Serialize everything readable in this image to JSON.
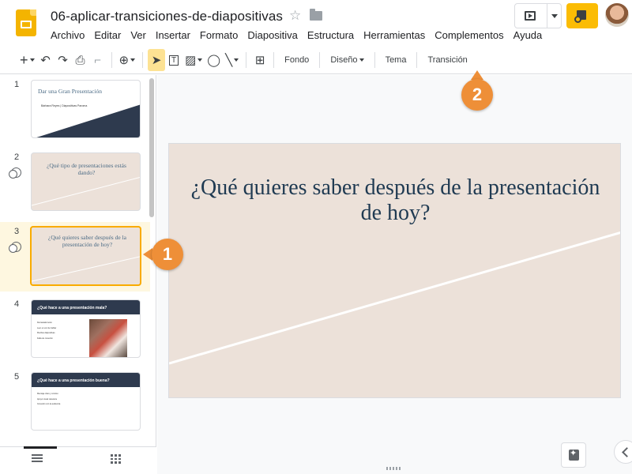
{
  "app": {
    "doc_title": "06-aplicar-transiciones-de-diapositivas",
    "menu": [
      "Archivo",
      "Editar",
      "Ver",
      "Insertar",
      "Formato",
      "Diapositiva",
      "Estructura",
      "Herramientas",
      "Complementos",
      "Ayuda"
    ]
  },
  "toolbar": {
    "fondo": "Fondo",
    "diseno": "Diseño",
    "tema": "Tema",
    "transicion": "Transición"
  },
  "filmstrip": {
    "slides": [
      {
        "number": "1",
        "title": "Dar una Gran Presentación",
        "subtitle": "Bárbara Reyes | Diapositivas Paroma",
        "has_transition": false
      },
      {
        "number": "2",
        "title": "¿Qué tipo de presentaciones estás dando?",
        "has_transition": true
      },
      {
        "number": "3",
        "title": "¿Qué quieres saber después de la presentación de hoy?",
        "has_transition": true,
        "selected": true
      },
      {
        "number": "4",
        "title": "¿Qué hace a una presentación mala?",
        "bullets": [
          "Demasiado texto",
          "Leer en vez de hablar",
          "Muchas diapositivas",
          "Falta de conexión"
        ]
      },
      {
        "number": "5",
        "title": "¿Qué hace a una presentación buena?",
        "bullets": [
          "Mensaje claro y conciso",
          "Apoyo visual relevante",
          "Conexión con la audiencia"
        ]
      }
    ]
  },
  "canvas": {
    "slide_title": "¿Qué quieres saber después de la presentación de hoy?"
  },
  "callouts": {
    "one": "1",
    "two": "2"
  },
  "colors": {
    "accent_orange": "#ee8f38",
    "slide_beige": "#ece1d9",
    "slide_title": "#1f3a52",
    "selected_thumb_border": "#f9ab00",
    "share_button": "#fbbc04"
  }
}
